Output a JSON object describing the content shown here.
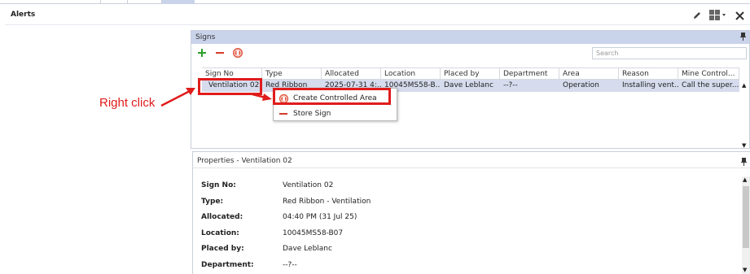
{
  "window": {
    "title": "Alerts"
  },
  "colors": {
    "accent": "#c9d3ea",
    "selection": "#d6dced",
    "annotation": "#e01c1c",
    "add": "#2aa02a",
    "remove": "#d73a2a"
  },
  "signs": {
    "title": "Signs",
    "search_placeholder": "Search",
    "toolbar": {
      "add_icon": "plus-icon",
      "remove_icon": "minus-icon",
      "controlled_area_icon": "controlled-area-icon"
    },
    "columns": [
      "Sign No",
      "Type",
      "Allocated",
      "Location",
      "Placed by",
      "Department",
      "Area",
      "Reason",
      "Mine Control..."
    ],
    "rows": [
      {
        "sign_no": "Ventilation 02",
        "type": "Red Ribbon",
        "allocated": "2025-07-31 4:...",
        "location": "10045MS58-B...",
        "placed_by": "Dave Leblanc",
        "department": "--?--",
        "area": "Operation",
        "reason": "Installing vent...",
        "mine_control": "Call the super..."
      }
    ]
  },
  "context_menu": {
    "items": [
      {
        "label": "Create Controlled Area",
        "icon": "controlled-area-icon"
      },
      {
        "label": "Store Sign",
        "icon": "minus-icon"
      }
    ]
  },
  "properties": {
    "title": "Properties - Ventilation 02",
    "fields": [
      {
        "label": "Sign No:",
        "value": "Ventilation 02"
      },
      {
        "label": "Type:",
        "value": "Red Ribbon - Ventilation"
      },
      {
        "label": "Allocated:",
        "value": "04:40 PM (31 Jul 25)"
      },
      {
        "label": "Location:",
        "value": "10045MS58-B07"
      },
      {
        "label": "Placed by:",
        "value": "Dave Leblanc"
      },
      {
        "label": "Department:",
        "value": "--?--"
      }
    ]
  },
  "annotation": {
    "text": "Right click"
  }
}
